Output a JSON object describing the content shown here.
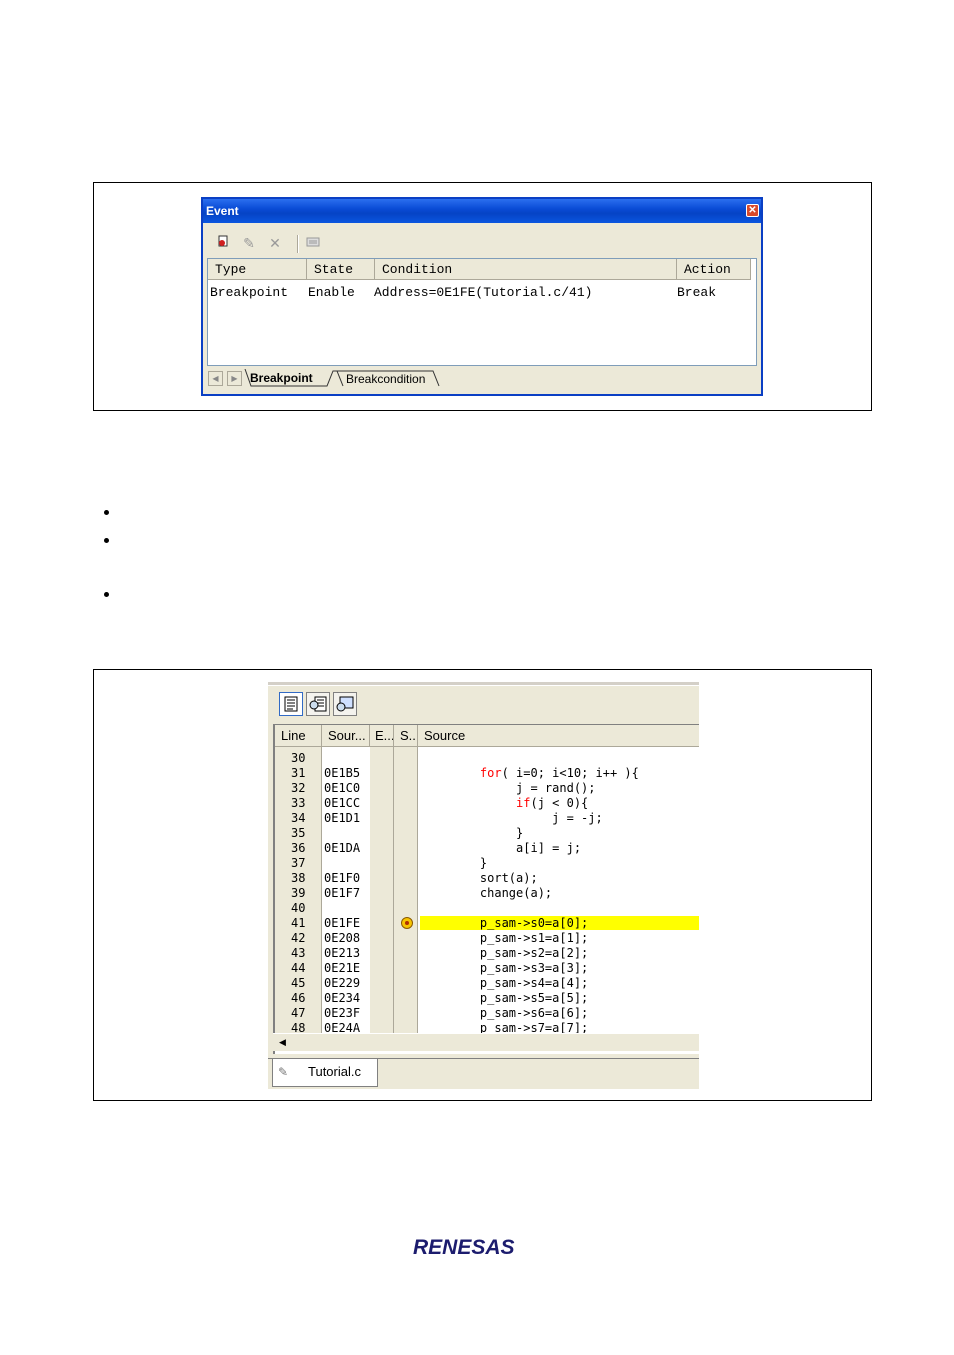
{
  "event_window": {
    "title": "Event",
    "close_glyph": "✕",
    "toolbar_icons": [
      "new-icon",
      "edit-icon",
      "delete-icon",
      "properties-icon"
    ],
    "columns": [
      "Type",
      "State",
      "Condition",
      "Action"
    ],
    "rows": [
      {
        "type": "Breakpoint",
        "state": "Enable",
        "condition": "Address=0E1FE(Tutorial.c/41)",
        "action": "Break"
      }
    ],
    "tabs": [
      {
        "label": "Breakpoint",
        "active": true
      },
      {
        "label": "Breakcondition",
        "active": false
      }
    ]
  },
  "editor": {
    "toolbar_icons": [
      "source-mode-icon",
      "mixed-mode-icon",
      "disassembly-mode-icon"
    ],
    "columns": {
      "line": "Line",
      "address": "Sour...",
      "event": "E...",
      "status": "S...",
      "source": "Source"
    },
    "rows": [
      {
        "line": "30",
        "address": "",
        "source": ""
      },
      {
        "line": "31",
        "address": "0E1B5",
        "source": "    for( i=0; i<10; i++ ){"
      },
      {
        "line": "32",
        "address": "0E1C0",
        "source": "         j = rand();"
      },
      {
        "line": "33",
        "address": "0E1CC",
        "source": "         if(j < 0){"
      },
      {
        "line": "34",
        "address": "0E1D1",
        "source": "              j = -j;"
      },
      {
        "line": "35",
        "address": "",
        "source": "         }"
      },
      {
        "line": "36",
        "address": "0E1DA",
        "source": "         a[i] = j;"
      },
      {
        "line": "37",
        "address": "",
        "source": "    }"
      },
      {
        "line": "38",
        "address": "0E1F0",
        "source": "    sort(a);"
      },
      {
        "line": "39",
        "address": "0E1F7",
        "source": "    change(a);"
      },
      {
        "line": "40",
        "address": "",
        "source": ""
      },
      {
        "line": "41",
        "address": "0E1FE",
        "source": "    p_sam->s0=a[0];"
      },
      {
        "line": "42",
        "address": "0E208",
        "source": "    p_sam->s1=a[1];"
      },
      {
        "line": "43",
        "address": "0E213",
        "source": "    p_sam->s2=a[2];"
      },
      {
        "line": "44",
        "address": "0E21E",
        "source": "    p_sam->s3=a[3];"
      },
      {
        "line": "45",
        "address": "0E229",
        "source": "    p_sam->s4=a[4];"
      },
      {
        "line": "46",
        "address": "0E234",
        "source": "    p_sam->s5=a[5];"
      },
      {
        "line": "47",
        "address": "0E23F",
        "source": "    p_sam->s6=a[6];"
      },
      {
        "line": "48",
        "address": "0E24A",
        "source": "    p_sam->s7=a[7];"
      }
    ],
    "highlight_line": "41",
    "highlight_color": "#ffff00",
    "keyword_color": "#ff0000",
    "tab_label": "Tutorial.c"
  },
  "logo_text": "RENESAS"
}
